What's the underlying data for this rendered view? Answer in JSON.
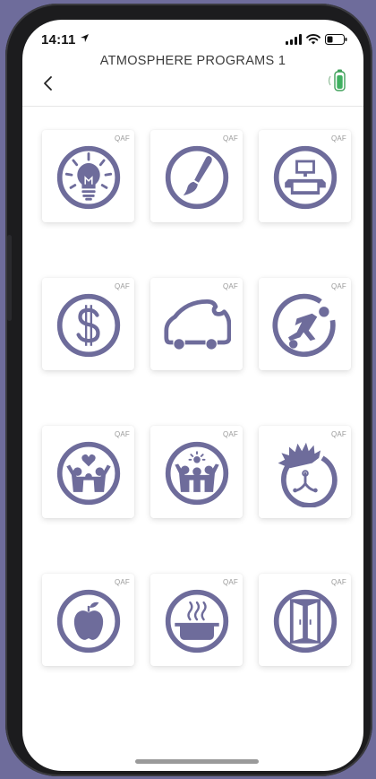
{
  "status": {
    "time": "14:11"
  },
  "header": {
    "title": "ATMOSPHERE PROGRAMS 1"
  },
  "tiles": [
    {
      "badge": "QAF",
      "icon": "lightbulb-icon"
    },
    {
      "badge": "QAF",
      "icon": "paintbrush-icon"
    },
    {
      "badge": "QAF",
      "icon": "computer-desk-icon"
    },
    {
      "badge": "QAF",
      "icon": "dollar-icon"
    },
    {
      "badge": "QAF",
      "icon": "car-icon"
    },
    {
      "badge": "QAF",
      "icon": "soccer-player-icon"
    },
    {
      "badge": "QAF",
      "icon": "family-heart-icon"
    },
    {
      "badge": "QAF",
      "icon": "family-sun-icon"
    },
    {
      "badge": "QAF",
      "icon": "fireplace-burst-icon"
    },
    {
      "badge": "QAF",
      "icon": "apple-icon"
    },
    {
      "badge": "QAF",
      "icon": "cooking-pot-icon"
    },
    {
      "badge": "QAF",
      "icon": "wardrobe-icon"
    }
  ],
  "colors": {
    "icon": "#6e6c9b",
    "background": "#6e6c9b"
  }
}
